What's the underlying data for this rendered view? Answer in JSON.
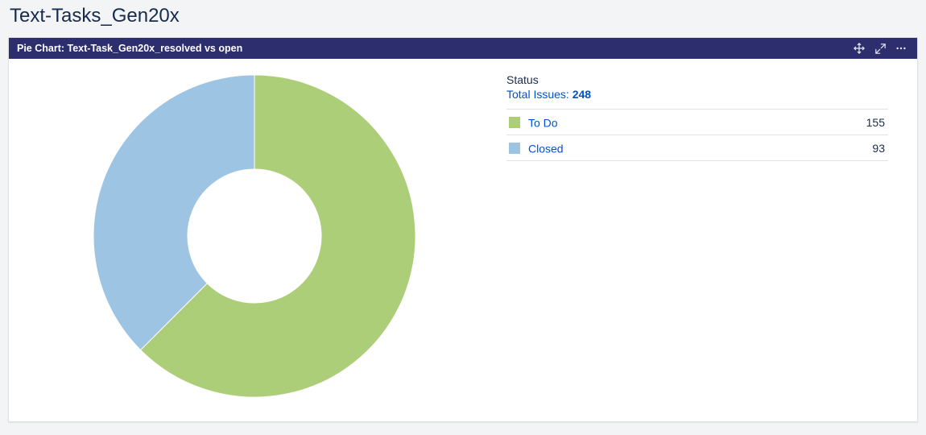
{
  "page_title": "Text-Tasks_Gen20x",
  "gadget": {
    "title": "Pie Chart: Text-Task_Gen20x_resolved vs open"
  },
  "status_label": "Status",
  "total_label": "Total Issues: ",
  "chart_data": {
    "type": "pie",
    "title": "Pie Chart: Text-Task_Gen20x_resolved vs open",
    "total": 248,
    "series": [
      {
        "name": "To Do",
        "value": 155,
        "color": "#adce79"
      },
      {
        "name": "Closed",
        "value": 93,
        "color": "#9ec4e3"
      }
    ]
  }
}
